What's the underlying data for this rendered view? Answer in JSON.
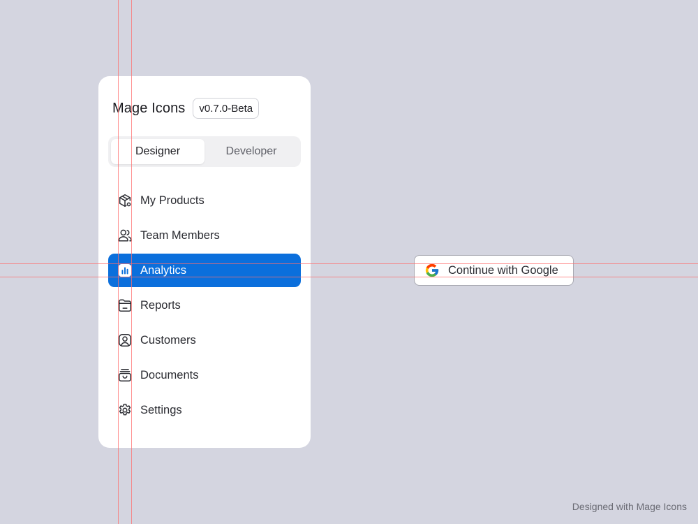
{
  "header": {
    "title": "Mage Icons",
    "version": "v0.7.0-Beta"
  },
  "segmented": {
    "options": [
      {
        "label": "Designer",
        "active": true
      },
      {
        "label": "Developer",
        "active": false
      }
    ]
  },
  "nav": {
    "items": [
      {
        "label": "My Products",
        "icon": "box-icon",
        "active": false
      },
      {
        "label": "Team Members",
        "icon": "users-icon",
        "active": false
      },
      {
        "label": "Analytics",
        "icon": "analytics-icon",
        "active": true
      },
      {
        "label": "Reports",
        "icon": "folder-icon",
        "active": false
      },
      {
        "label": "Customers",
        "icon": "user-square-icon",
        "active": false
      },
      {
        "label": "Documents",
        "icon": "archive-icon",
        "active": false
      },
      {
        "label": "Settings",
        "icon": "gear-icon",
        "active": false
      }
    ]
  },
  "google_button": {
    "label": "Continue with Google",
    "icon": "google-icon"
  },
  "footer": {
    "credit": "Designed with Mage Icons"
  },
  "colors": {
    "background": "#d4d5e0",
    "panel": "#ffffff",
    "accent": "#0b6fdc",
    "guide": "#ff6e6e"
  }
}
